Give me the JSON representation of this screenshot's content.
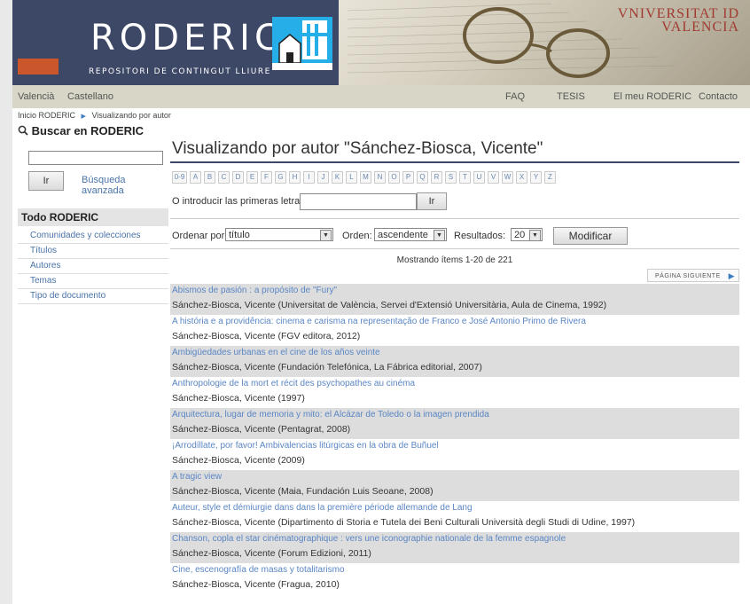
{
  "header": {
    "logo_text": "RODERIC",
    "logo_subtitle": "REPOSITORI DE CONTINGUT LLIURE",
    "university_line1": "VNIVERSITAT ID",
    "university_line2": "VALENCIA"
  },
  "navbar": {
    "lang_valencia": "Valencià",
    "lang_castellano": "Castellano",
    "faq": "FAQ",
    "tesis": "TESIS",
    "my_roderic": "El meu RODERIC",
    "contact": "Contacto"
  },
  "breadcrumb": {
    "home": "Inicio RODERIC",
    "separator": "▶",
    "current": "Visualizando por autor"
  },
  "sidebar": {
    "search_title": "Buscar en RODERIC",
    "search_value": "",
    "go_label": "Ir",
    "advanced_label": "Búsqueda avanzada",
    "section_title": "Todo RODERIC",
    "items": [
      {
        "label": "Comunidades y colecciones"
      },
      {
        "label": "Títulos"
      },
      {
        "label": "Autores"
      },
      {
        "label": "Temas"
      },
      {
        "label": "Tipo de documento"
      }
    ]
  },
  "main": {
    "title": "Visualizando por autor \"Sánchez-Biosca, Vicente\"",
    "letters": [
      "0-9",
      "A",
      "B",
      "C",
      "D",
      "E",
      "F",
      "G",
      "H",
      "I",
      "J",
      "K",
      "L",
      "M",
      "N",
      "O",
      "P",
      "Q",
      "R",
      "S",
      "T",
      "U",
      "V",
      "W",
      "X",
      "Y",
      "Z"
    ],
    "initials_label": "O introducir las primeras letras:",
    "initials_value": "",
    "go_label": "Ir",
    "sort_label": "Ordenar por:",
    "sort_value": "título",
    "order_label": "Orden:",
    "order_value": "ascendente",
    "results_label": "Resultados:",
    "results_value": "20",
    "modify_label": "Modificar",
    "showing_text": "Mostrando ítems 1-20 de 221",
    "next_page_label": "PÁGINA SIGUIENTE",
    "items": [
      {
        "title": "Abismos de pasión : a propósito de \"Fury\"",
        "author": "Sánchez-Biosca, Vicente (Universitat de València, Servei d'Extensió Universitària, Aula de Cinema, 1992)"
      },
      {
        "title": "A história e a providência: cinema e carisma na representação de Franco e José Antonio Primo de Rivera",
        "author": "Sánchez-Biosca, Vicente (FGV editora, 2012)"
      },
      {
        "title": "Ambigüedades urbanas en el cine de los años veinte",
        "author": "Sánchez-Biosca, Vicente (Fundación Telefónica, La Fábrica editorial, 2007)"
      },
      {
        "title": "Anthropologie de la mort et récit des psychopathes au cinéma",
        "author": "Sánchez-Biosca, Vicente (1997)"
      },
      {
        "title": "Arquitectura, lugar de memoria y mito: el Alcázar de Toledo o la imagen prendida",
        "author": "Sánchez-Biosca, Vicente (Pentagrat, 2008)"
      },
      {
        "title": "¡Arrodíllate, por favor! Ambivalencias litúrgicas en la obra de Buñuel",
        "author": "Sánchez-Biosca, Vicente (2009)"
      },
      {
        "title": "A tragic view",
        "author": "Sánchez-Biosca, Vicente (Maia, Fundación Luis Seoane, 2008)"
      },
      {
        "title": "Auteur, style et démiurgie dans dans la première période allemande de Lang",
        "author": "Sánchez-Biosca, Vicente (Dipartimento di Storia e Tutela dei Beni Culturali Università degli Studi di Udine, 1997)"
      },
      {
        "title": "Chanson, copla el star cinématographique : vers une iconographie nationale de la femme espagnole",
        "author": "Sánchez-Biosca, Vicente (Forum Edizioni, 2011)"
      },
      {
        "title": "Cine, escenografía de masas y totalitarismo",
        "author": "Sánchez-Biosca, Vicente (Fragua, 2010)"
      }
    ]
  }
}
